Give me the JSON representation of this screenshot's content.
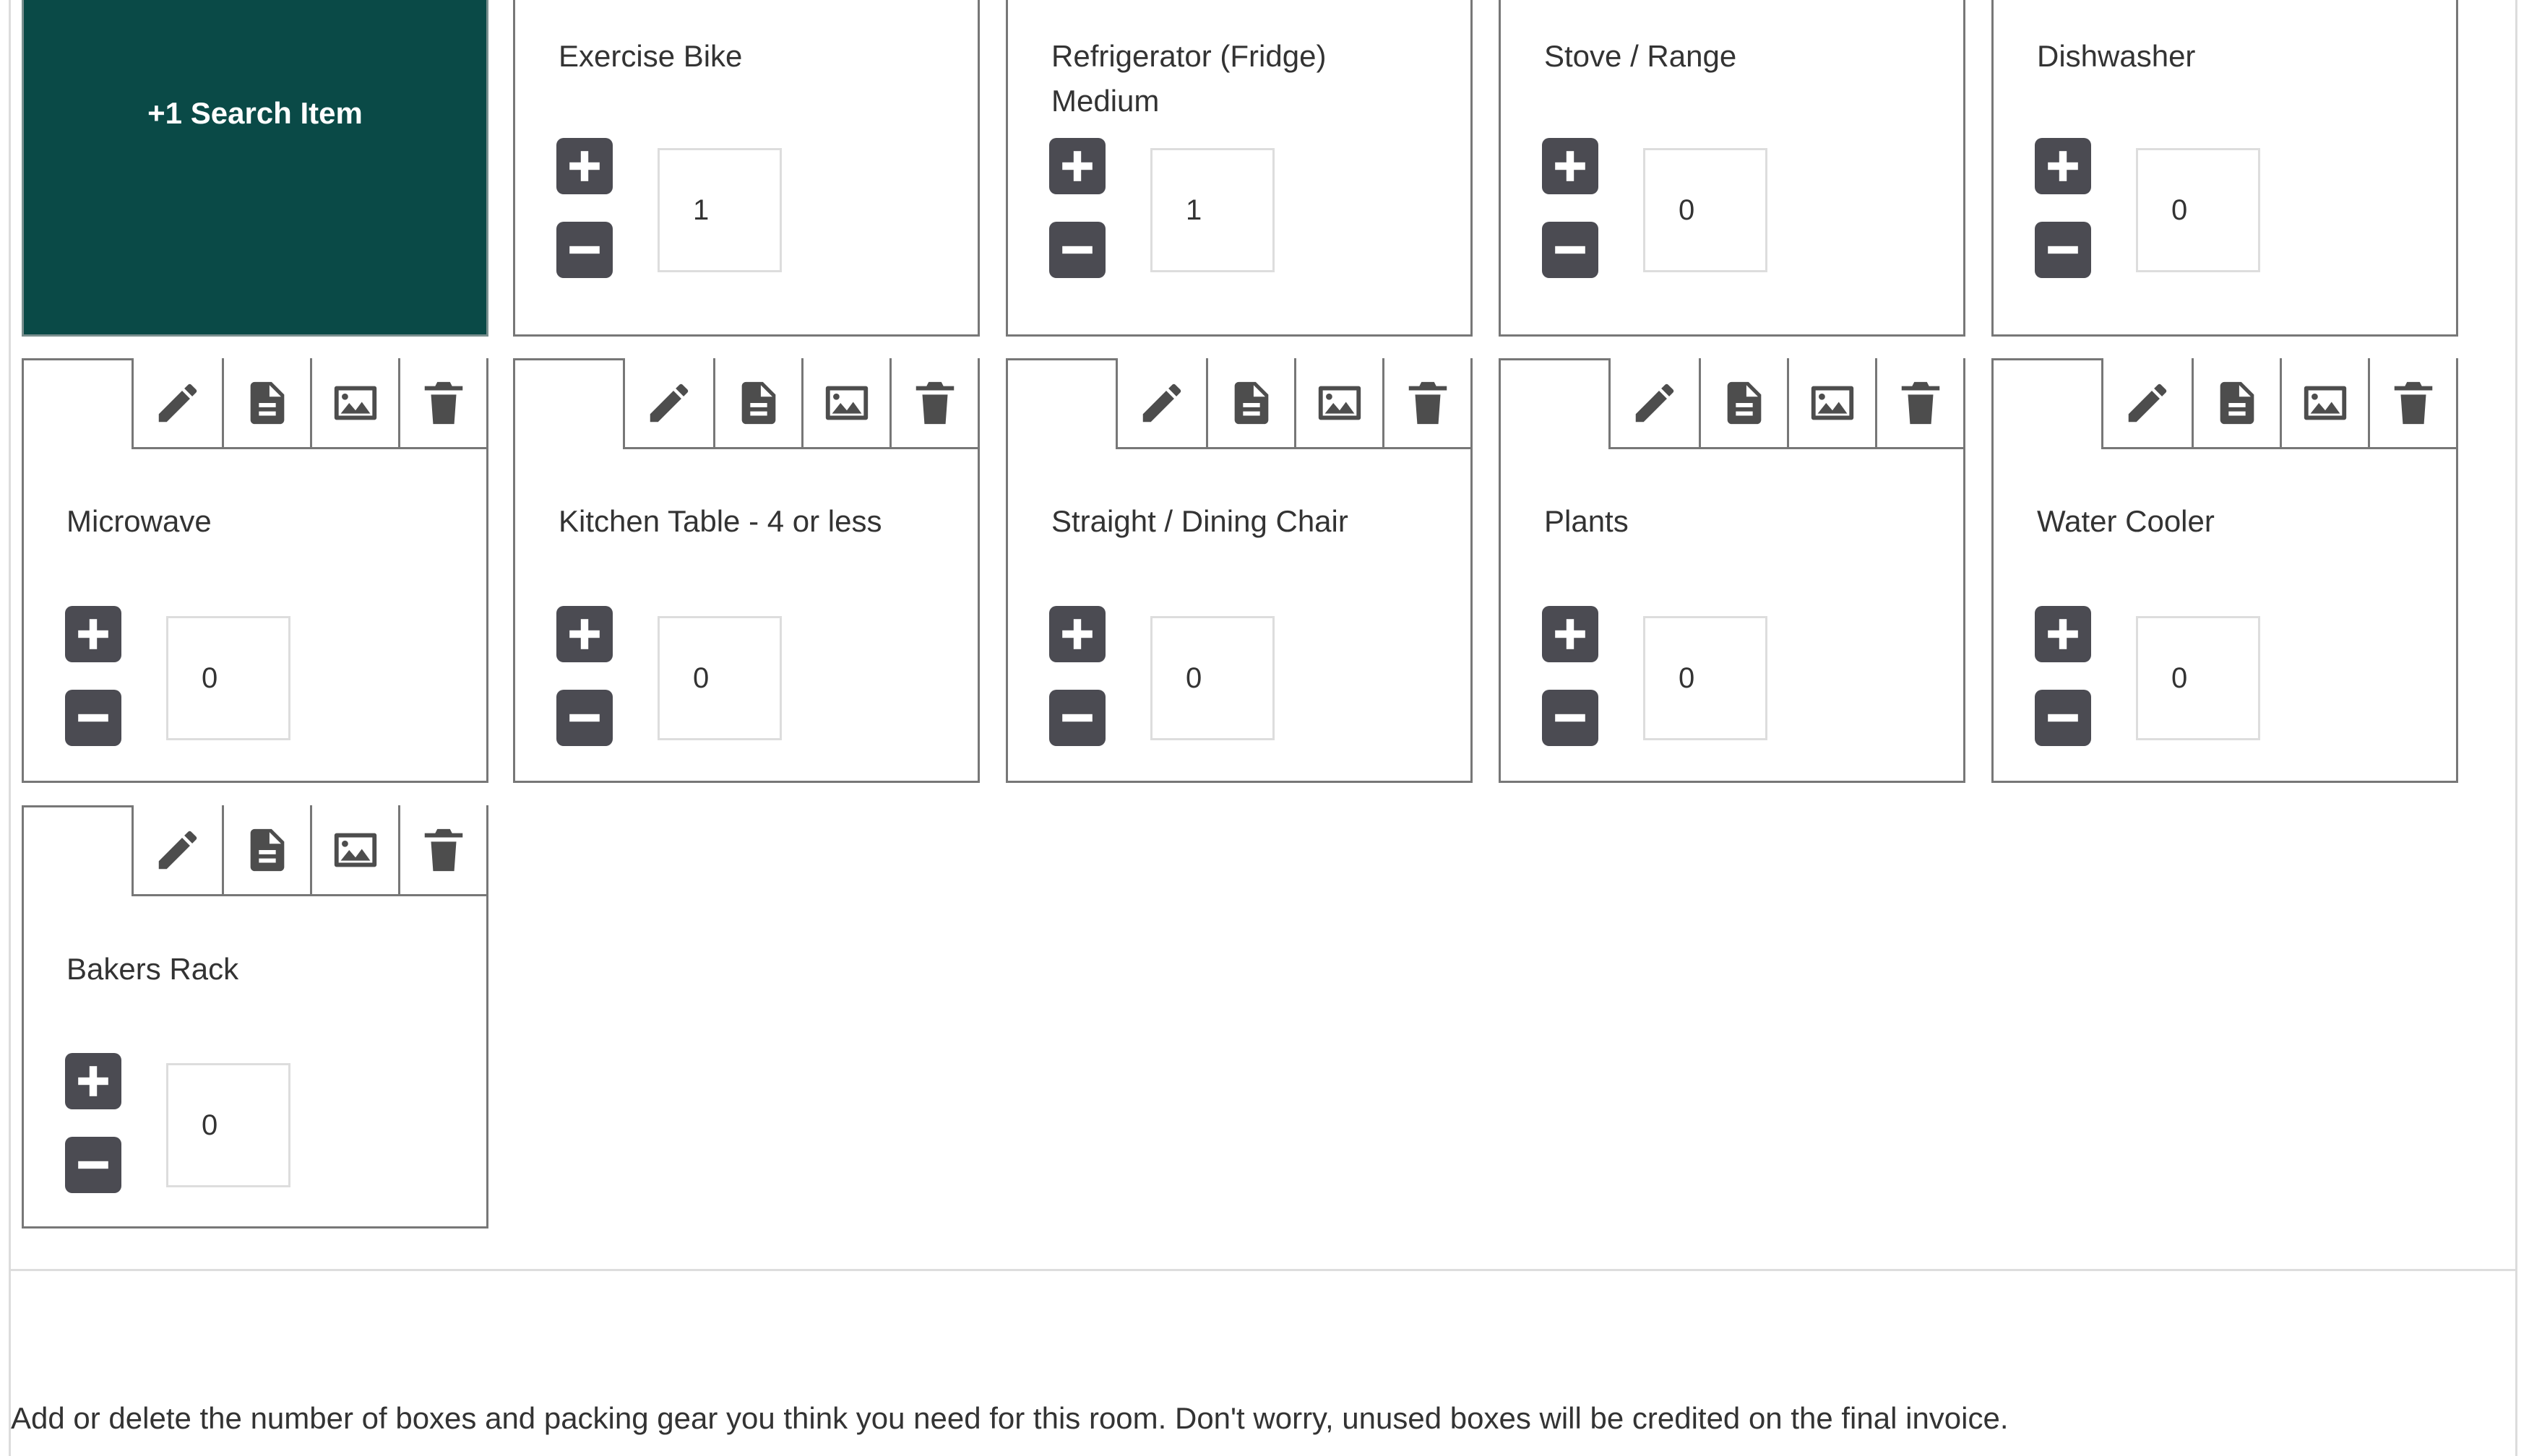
{
  "search_tile": {
    "label": "+1 Search Item"
  },
  "items": [
    {
      "name": "Exercise Bike",
      "quantity": "1"
    },
    {
      "name": "Refrigerator (Fridge) Medium",
      "name_line1": "Refrigerator (Fridge)",
      "name_line2": "Medium",
      "quantity": "1"
    },
    {
      "name": "Stove / Range",
      "quantity": "0"
    },
    {
      "name": "Dishwasher",
      "quantity": "0"
    },
    {
      "name": "Microwave",
      "quantity": "0"
    },
    {
      "name": "Kitchen Table - 4 or less",
      "quantity": "0"
    },
    {
      "name": "Straight / Dining Chair",
      "quantity": "0"
    },
    {
      "name": "Plants",
      "quantity": "0"
    },
    {
      "name": "Water Cooler",
      "quantity": "0"
    },
    {
      "name": "Bakers Rack",
      "quantity": "0"
    }
  ],
  "toolbar_icons": [
    "pencil-icon",
    "document-icon",
    "image-icon",
    "trash-icon"
  ],
  "stepper_icons": [
    "plus-icon",
    "minus-icon"
  ],
  "footer": {
    "note": "Add or delete the number of boxes and packing gear you think you need for this room. Don't worry, unused boxes will be credited on the final invoice."
  },
  "colors": {
    "search_tile_bg": "#0a4a47",
    "button_bg": "#4b4b52",
    "tile_border": "#777777"
  }
}
